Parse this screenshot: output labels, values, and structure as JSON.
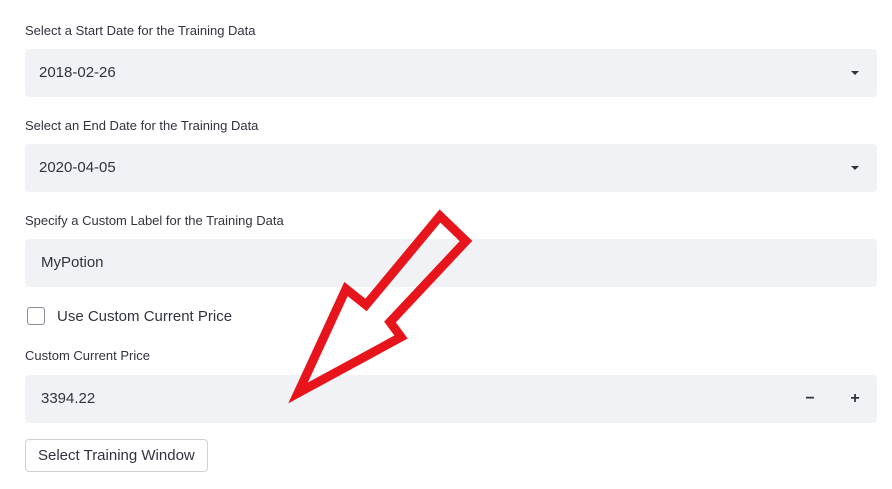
{
  "start_date": {
    "label": "Select a Start Date for the Training Data",
    "value": "2018-02-26"
  },
  "end_date": {
    "label": "Select an End Date for the Training Data",
    "value": "2020-04-05"
  },
  "custom_label": {
    "label": "Specify a Custom Label for the Training Data",
    "value": "MyPotion"
  },
  "use_custom_price": {
    "label": "Use Custom Current Price",
    "checked": false
  },
  "custom_price": {
    "label": "Custom Current Price",
    "value": "3394.22",
    "minus": "−",
    "plus": "+"
  },
  "submit_button": {
    "label": "Select Training Window"
  },
  "annotation": {
    "arrow_color": "#e8141c"
  }
}
